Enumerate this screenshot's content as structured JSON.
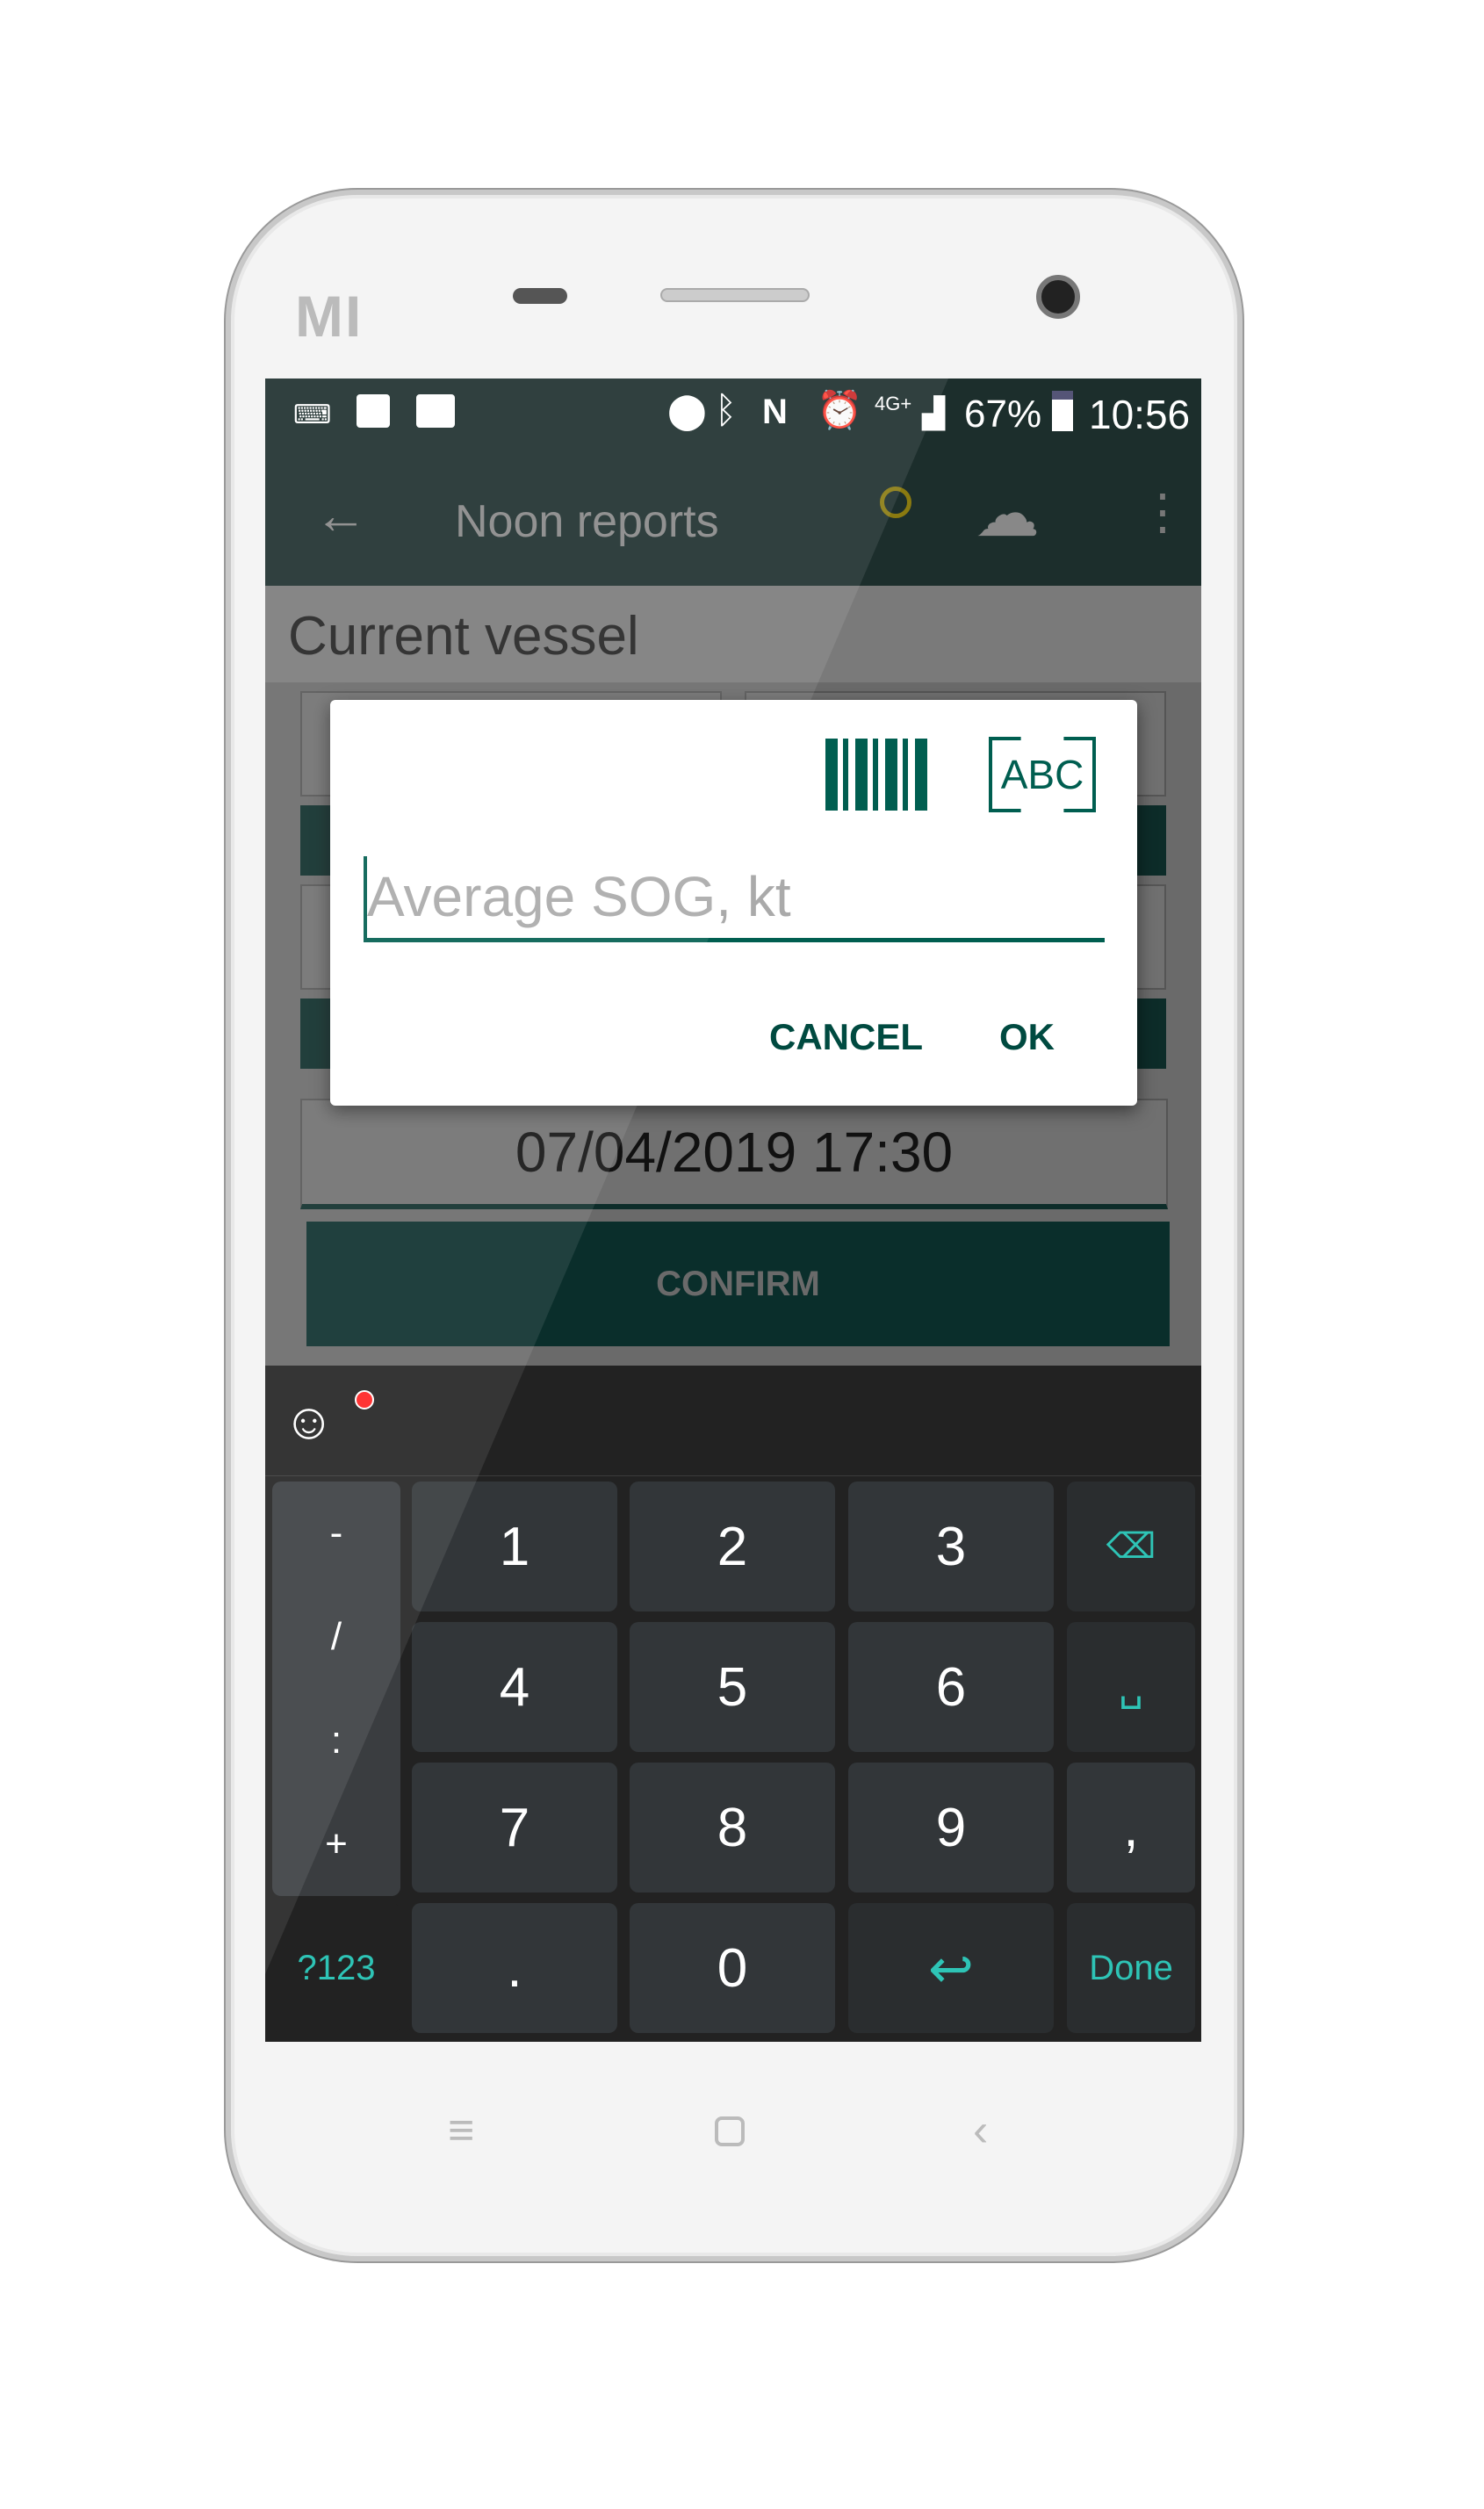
{
  "device": {
    "brand_logo": "MI"
  },
  "status_bar": {
    "battery": "67%",
    "time": "10:56",
    "network": "4G+",
    "icons": [
      "keyboard-icon",
      "image-icon",
      "pulse-icon",
      "location-icon",
      "bluetooth-icon",
      "nfc-icon",
      "alarm-icon",
      "signal-icon",
      "battery-icon"
    ]
  },
  "toolbar": {
    "title": "Noon reports",
    "icons": [
      "back-arrow-icon",
      "location-clock-icon",
      "cloud-check-icon",
      "more-vert-icon"
    ]
  },
  "page": {
    "section_title": "Current vessel",
    "date_value": "07/04/2019 17:30",
    "confirm_label": "CONFIRM"
  },
  "dialog": {
    "input_placeholder": "Average SOG, kt",
    "input_value": "",
    "scan_text_label": "ABC",
    "cancel_label": "CANCEL",
    "ok_label": "OK",
    "accent": "#005e50"
  },
  "keyboard": {
    "side_keys": [
      "-",
      "/",
      ":",
      "+"
    ],
    "digits": [
      "1",
      "2",
      "3",
      "4",
      "5",
      "6",
      "7",
      "8",
      "9"
    ],
    "bottom": {
      "symbols": "?123",
      "dot": ".",
      "zero": "0",
      "done": "Done"
    },
    "comma": ",",
    "accent": "#2ec4b6"
  },
  "colors": {
    "app_bar": "#1c2e2c",
    "keyboard_bg": "#222222",
    "key_bg": "#323639"
  }
}
